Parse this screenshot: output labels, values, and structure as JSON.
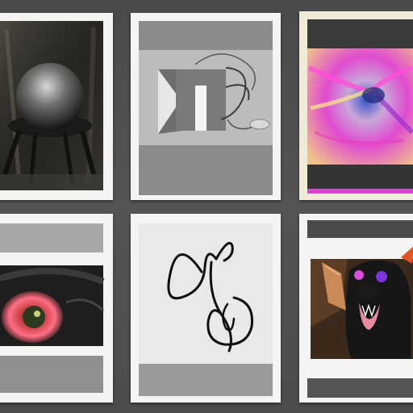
{
  "gallery": {
    "background": "#505050",
    "items": [
      {
        "subject": "sphere-on-stand",
        "palette": [
          "#2a2a28",
          "#8a8a86",
          "#f4f4f2"
        ]
      },
      {
        "subject": "abstract-geometric-shapes",
        "palette": [
          "#7a7a7a",
          "#bdbdbd",
          "#f4f4f2"
        ]
      },
      {
        "subject": "colorful-abstract-creature",
        "palette": [
          "#e43fd0",
          "#f0c060",
          "#2b2b2b"
        ]
      },
      {
        "subject": "glowing-eye",
        "palette": [
          "#ff5a78",
          "#1e1e1e",
          "#a9a9a9"
        ]
      },
      {
        "subject": "ink-line-drawing",
        "palette": [
          "#111111",
          "#e8e8e6",
          "#9a9a9a"
        ]
      },
      {
        "subject": "horned-dark-creature",
        "palette": [
          "#1a1a1a",
          "#7c2bd6",
          "#c98050"
        ]
      }
    ]
  }
}
